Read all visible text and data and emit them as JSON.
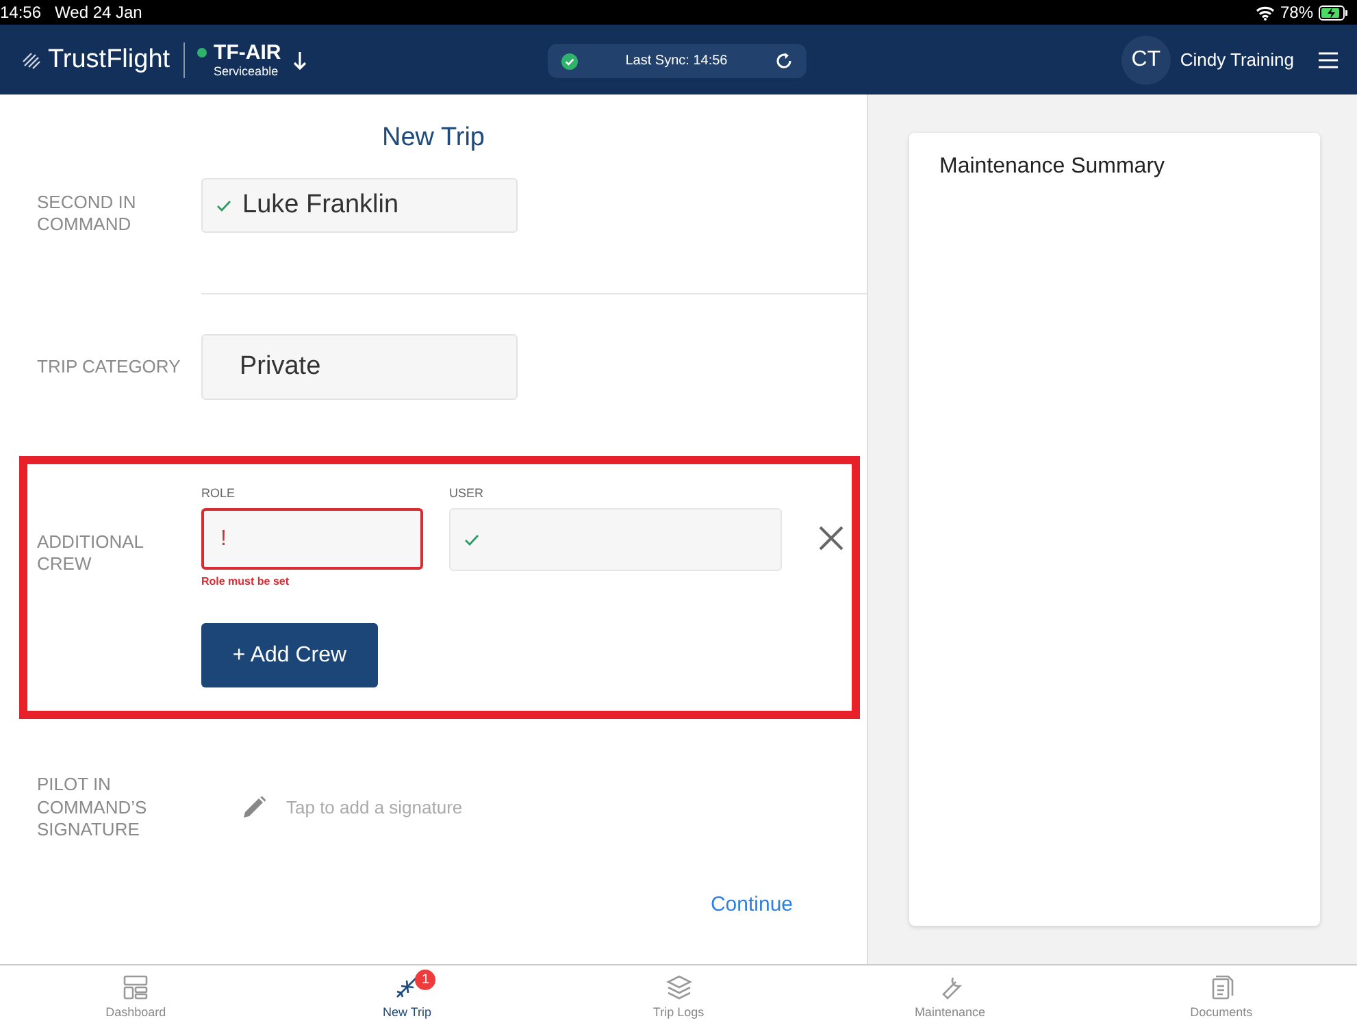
{
  "status_bar": {
    "time": "14:56",
    "date": "Wed 24 Jan",
    "battery": "78%",
    "charging": true
  },
  "header": {
    "logo": "TrustFlight",
    "aircraft": "TF-AIR",
    "aircraft_status": "Serviceable",
    "serviceable": true,
    "sync": "Last Sync: 14:56",
    "synced": true,
    "initials": "CT",
    "user": "Cindy Training"
  },
  "form": {
    "title": "New Trip",
    "second_in_command": {
      "label": "SECOND IN COMMAND",
      "value": "Luke Franklin",
      "valid": true
    },
    "trip_category": {
      "label": "TRIP CATEGORY",
      "value": "Private"
    },
    "additional_crew": {
      "label": "ADDITIONAL CREW",
      "highlighted": true,
      "role": {
        "label": "ROLE",
        "mark": "!",
        "error": "Role must be set",
        "valid": false
      },
      "user": {
        "label": "USER",
        "valid": true
      },
      "add_button": "+ Add Crew"
    },
    "signature": {
      "label": "PILOT IN COMMAND’S SIGNATURE",
      "placeholder": "Tap to add a signature"
    },
    "continue": "Continue"
  },
  "summary": {
    "title": "Maintenance Summary"
  },
  "tabs": [
    {
      "label": "Dashboard",
      "selected": false
    },
    {
      "label": "New Trip",
      "selected": true,
      "badge": "1"
    },
    {
      "label": "Trip Logs",
      "selected": false
    },
    {
      "label": "Maintenance",
      "selected": false
    },
    {
      "label": "Documents",
      "selected": false
    }
  ]
}
